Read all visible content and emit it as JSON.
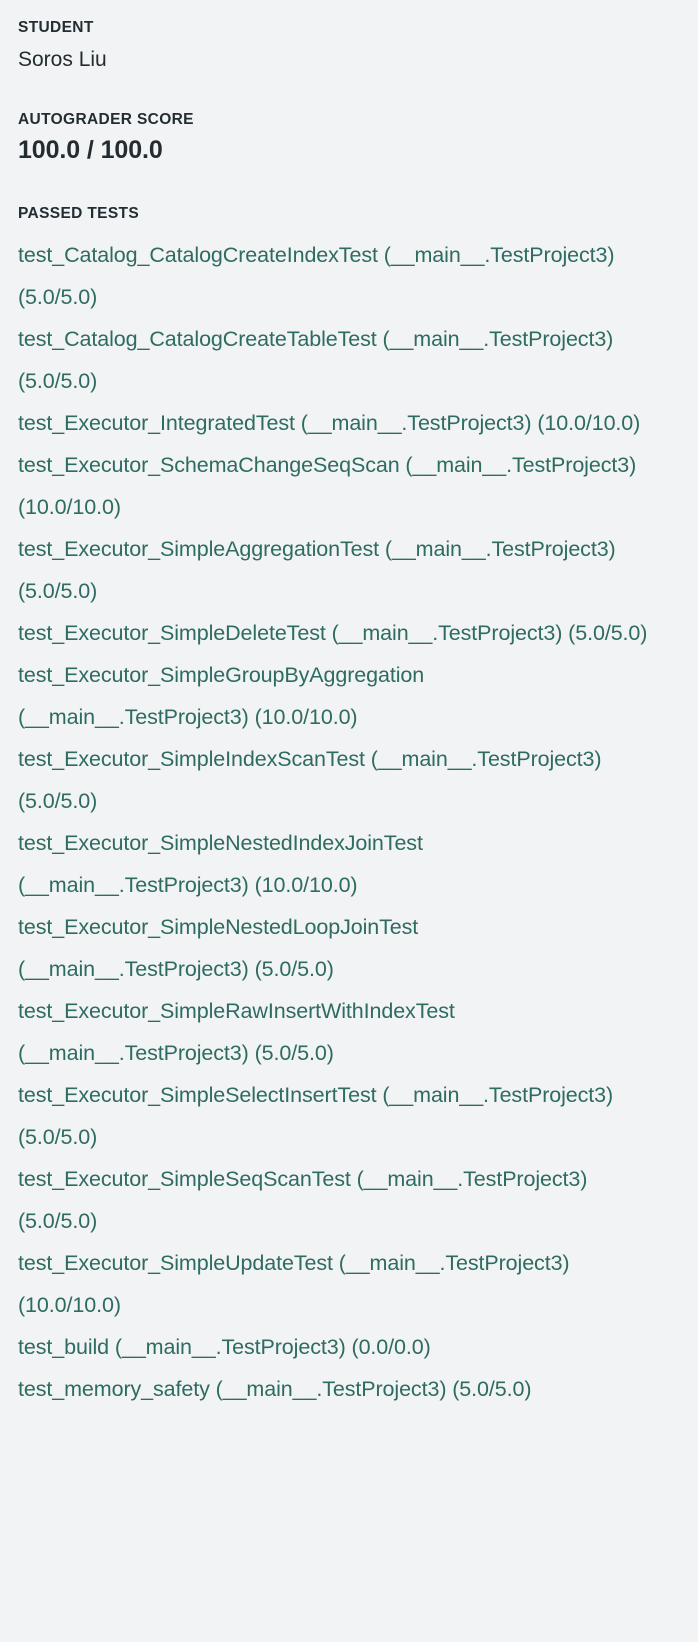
{
  "student": {
    "label": "STUDENT",
    "name": "Soros Liu"
  },
  "score": {
    "label": "AUTOGRADER SCORE",
    "value": "100.0 / 100.0",
    "earned": 100.0,
    "total": 100.0
  },
  "passed_tests": {
    "label": "PASSED TESTS",
    "items": [
      "test_Catalog_CatalogCreateIndexTest (__main__.TestProject3) (5.0/5.0)",
      "test_Catalog_CatalogCreateTableTest (__main__.TestProject3) (5.0/5.0)",
      "test_Executor_IntegratedTest (__main__.TestProject3) (10.0/10.0)",
      "test_Executor_SchemaChangeSeqScan (__main__.TestProject3) (10.0/10.0)",
      "test_Executor_SimpleAggregationTest (__main__.TestProject3) (5.0/5.0)",
      "test_Executor_SimpleDeleteTest (__main__.TestProject3) (5.0/5.0)",
      "test_Executor_SimpleGroupByAggregation (__main__.TestProject3) (10.0/10.0)",
      "test_Executor_SimpleIndexScanTest (__main__.TestProject3) (5.0/5.0)",
      "test_Executor_SimpleNestedIndexJoinTest (__main__.TestProject3) (10.0/10.0)",
      "test_Executor_SimpleNestedLoopJoinTest (__main__.TestProject3) (5.0/5.0)",
      "test_Executor_SimpleRawInsertWithIndexTest (__main__.TestProject3) (5.0/5.0)",
      "test_Executor_SimpleSelectInsertTest (__main__.TestProject3) (5.0/5.0)",
      "test_Executor_SimpleSeqScanTest (__main__.TestProject3) (5.0/5.0)",
      "test_Executor_SimpleUpdateTest (__main__.TestProject3) (10.0/10.0)",
      "test_build (__main__.TestProject3) (0.0/0.0)",
      "test_memory_safety (__main__.TestProject3) (5.0/5.0)"
    ]
  },
  "colors": {
    "background": "#f1f3f4",
    "text": "#232d31",
    "accent_passed": "#2e6b60"
  }
}
